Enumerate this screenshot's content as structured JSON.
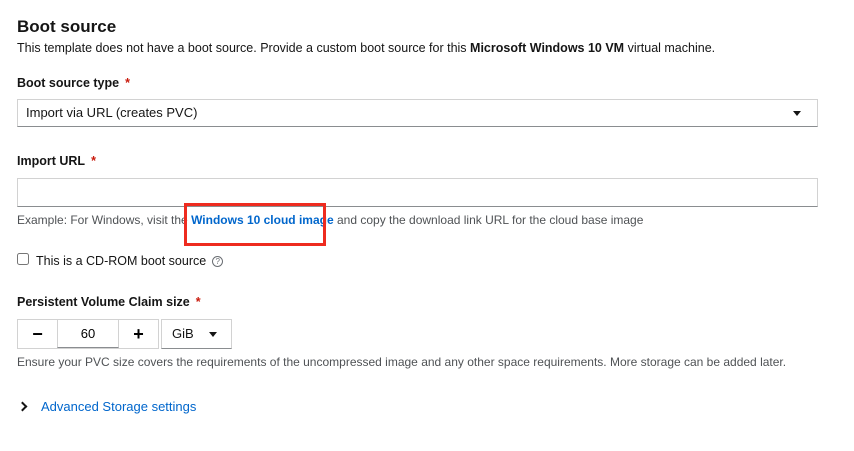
{
  "section": {
    "title": "Boot source",
    "description_prefix": "This template does not have a boot source. Provide a custom boot source for this ",
    "description_bold": "Microsoft Windows 10 VM",
    "description_suffix": " virtual machine."
  },
  "boot_source_type": {
    "label": "Boot source type",
    "required_mark": "*",
    "selected": "Import via URL (creates PVC)"
  },
  "import_url": {
    "label": "Import URL",
    "required_mark": "*",
    "value": "",
    "placeholder": "",
    "helper_prefix": "Example: For Windows, visit the ",
    "helper_link": "Windows 10 cloud image",
    "helper_suffix": " and copy the download link URL for the cloud base image"
  },
  "cdrom": {
    "label": "This is a CD-ROM boot source",
    "checked": false,
    "help_icon": "?"
  },
  "pvc_size": {
    "label": "Persistent Volume Claim size",
    "required_mark": "*",
    "minus": "−",
    "value": "60",
    "plus": "+",
    "unit": "GiB",
    "helper": "Ensure your PVC size covers the requirements of the uncompressed image and any other space requirements. More storage can be added later."
  },
  "advanced": {
    "label": "Advanced Storage settings"
  },
  "colors": {
    "link": "#0066cc",
    "required": "#c9190b",
    "highlight": "#ee2b1f"
  }
}
